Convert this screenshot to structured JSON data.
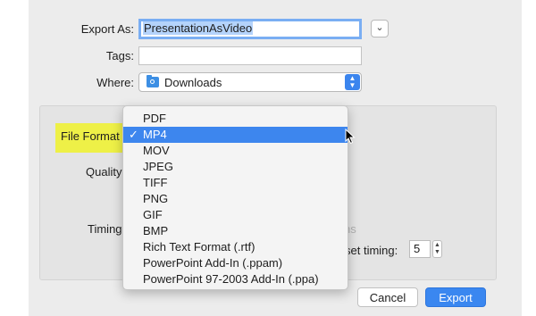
{
  "export_as": {
    "label": "Export As:",
    "value": "PresentationAsVideo"
  },
  "tags": {
    "label": "Tags:",
    "value": ""
  },
  "where": {
    "label": "Where:",
    "value": "Downloads"
  },
  "options": {
    "file_format_label": "File Format",
    "quality_label": "Quality",
    "timing_label": "Timing",
    "timing_partial_text": "ns",
    "preset_timing_label": "set timing:",
    "preset_timing_value": "5"
  },
  "format_menu": {
    "items": [
      "PDF",
      "MP4",
      "MOV",
      "JPEG",
      "TIFF",
      "PNG",
      "GIF",
      "BMP",
      "Rich Text Format (.rtf)",
      "PowerPoint Add-In (.ppam)",
      "PowerPoint 97-2003 Add-In (.ppa)"
    ],
    "selected": "MP4",
    "check_glyph": "✓"
  },
  "buttons": {
    "cancel": "Cancel",
    "export": "Export"
  },
  "colors": {
    "accent": "#3d86ee",
    "highlight": "#eef03e",
    "sheet_bg": "#ececec"
  }
}
